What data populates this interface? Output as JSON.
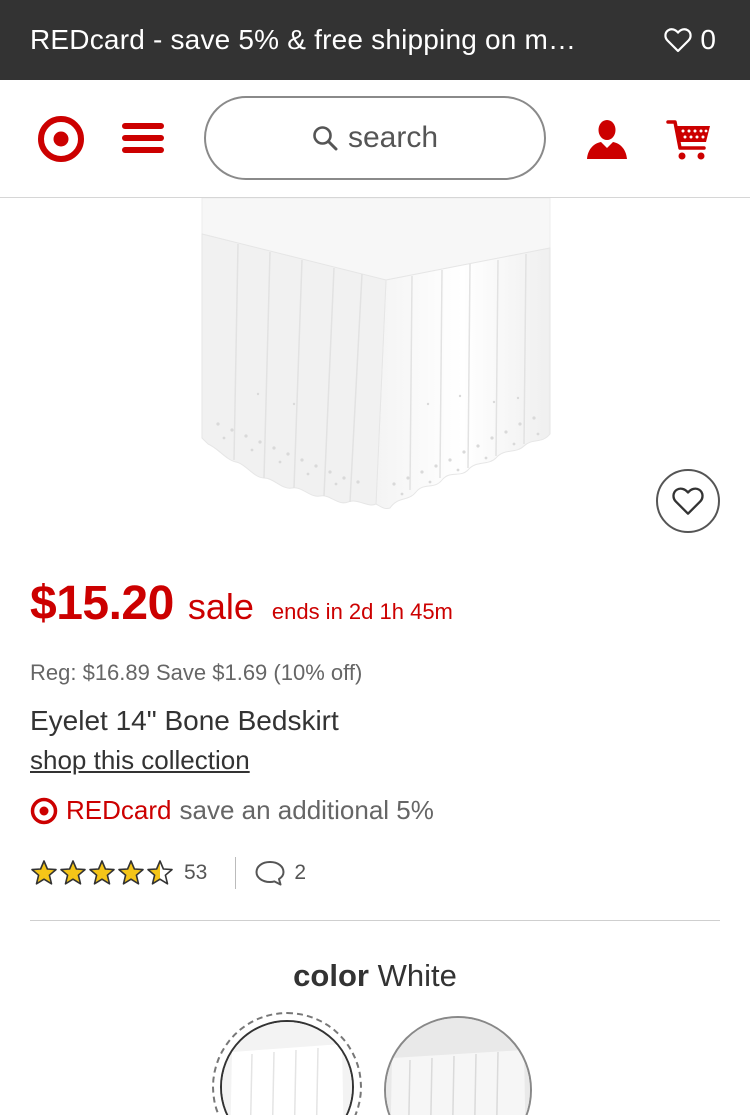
{
  "promo": {
    "text": "REDcard - save 5% & free shipping on m…",
    "favorites_count": "0"
  },
  "header": {
    "search_placeholder": "search"
  },
  "product": {
    "price": "$15.20",
    "sale_label": "sale",
    "sale_ends": "ends in 2d 1h 45m",
    "regular_price_text": "Reg: $16.89 Save $1.69 (10% off)",
    "title": "Eyelet 14\" Bone Bedskirt",
    "collection_link": "shop this collection",
    "redcard_name": "REDcard",
    "redcard_text": "save an additional 5%",
    "rating": 4.5,
    "rating_max": 5,
    "rating_count": "53",
    "question_count": "2"
  },
  "color": {
    "label": "color",
    "value": "White"
  },
  "colors": {
    "brand_red": "#cc0000",
    "promo_bg": "#333333",
    "star_fill": "#f5c518"
  }
}
